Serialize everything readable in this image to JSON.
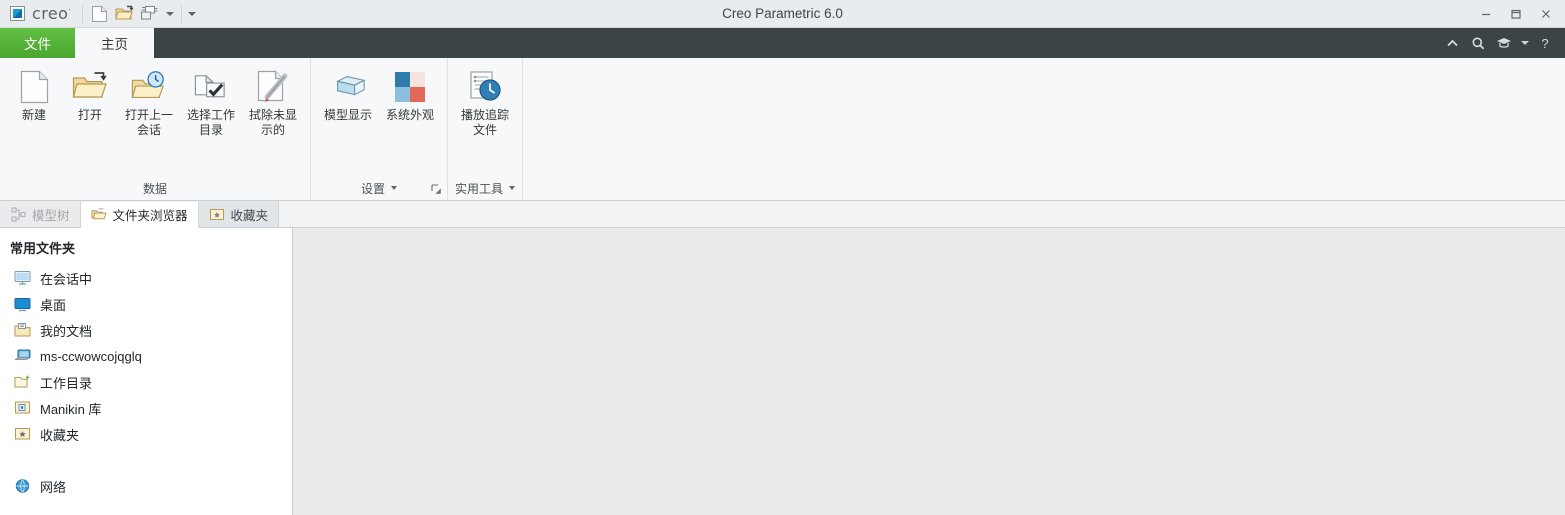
{
  "window": {
    "title": "Creo Parametric 6.0",
    "brand": "creo",
    "brand_sup": "·",
    "controls": {
      "minimize": "minimize-button",
      "maximize": "maximize-button",
      "close": "close-button"
    }
  },
  "quick_access": {
    "items": [
      {
        "name": "new-document-icon",
        "label": "新建"
      },
      {
        "name": "open-folder-icon",
        "label": "打开"
      },
      {
        "name": "window-cascade-icon",
        "label": "窗口"
      }
    ],
    "dropdown_label": "自定义快速访问工具栏"
  },
  "tabs": {
    "file": "文件",
    "home": "主页",
    "right_icons": [
      {
        "name": "collapse-ribbon-icon",
        "label": "折叠功能区"
      },
      {
        "name": "search-icon",
        "label": "搜索"
      },
      {
        "name": "learning-icon",
        "label": "学习连接"
      },
      {
        "name": "help-icon",
        "label": "?"
      }
    ]
  },
  "ribbon": {
    "groups": [
      {
        "label": "数据",
        "has_caret": false,
        "has_launcher": false,
        "buttons": [
          {
            "icon": "new-file-icon",
            "label": "新建"
          },
          {
            "icon": "open-file-icon",
            "label": "打开"
          },
          {
            "icon": "open-last-session-icon",
            "label": "打开上一会话"
          },
          {
            "icon": "select-working-dir-icon",
            "label": "选择工作目录"
          },
          {
            "icon": "erase-not-displayed-icon",
            "label": "拭除未显示的"
          }
        ]
      },
      {
        "label": "设置",
        "has_caret": true,
        "has_launcher": true,
        "buttons": [
          {
            "icon": "model-display-icon",
            "label": "模型显示"
          },
          {
            "icon": "system-appearance-icon",
            "label": "系统外观"
          }
        ]
      },
      {
        "label": "实用工具",
        "has_caret": true,
        "has_launcher": false,
        "buttons": [
          {
            "icon": "play-trail-file-icon",
            "label": "播放追踪文件"
          }
        ]
      }
    ]
  },
  "navigator_tabs": [
    {
      "icon": "model-tree-icon",
      "label": "模型树",
      "state": "disabled"
    },
    {
      "icon": "folder-browser-icon",
      "label": "文件夹浏览器",
      "state": "active"
    },
    {
      "icon": "favorites-icon",
      "label": "收藏夹",
      "state": "normal"
    }
  ],
  "navigator": {
    "header": "常用文件夹",
    "items": [
      {
        "icon": "in-session-icon",
        "label": "在会话中"
      },
      {
        "icon": "desktop-icon",
        "label": "桌面"
      },
      {
        "icon": "my-documents-icon",
        "label": "我的文档"
      },
      {
        "icon": "computer-icon",
        "label": "ms-ccwowcojqglq"
      },
      {
        "icon": "working-dir-icon",
        "label": "工作目录"
      },
      {
        "icon": "manikin-library-icon",
        "label": "Manikin 库"
      },
      {
        "icon": "favorites-folder-icon",
        "label": "收藏夹"
      }
    ],
    "network": {
      "icon": "network-globe-icon",
      "label": "网络"
    }
  },
  "colors": {
    "file_tab_green": "#4aa62e",
    "tabstrip_dark": "#3c4448",
    "titlebar": "#e9ecee",
    "ribbon_bg": "#f7f8f9",
    "workarea": "#e8eaec",
    "accent_blue": "#1a9ad6"
  }
}
